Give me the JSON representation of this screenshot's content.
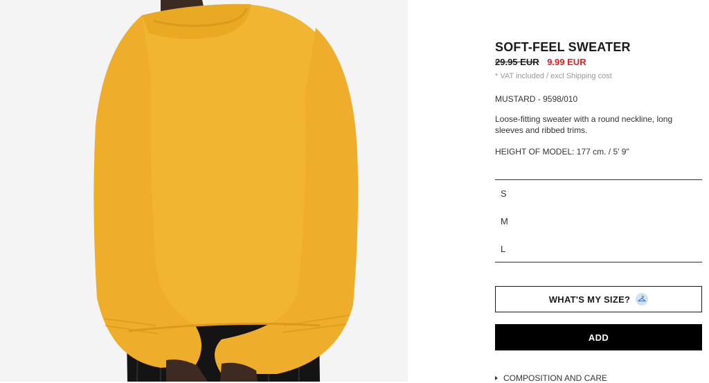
{
  "product": {
    "title": "SOFT-FEEL SWEATER",
    "old_price": "29.95 EUR",
    "new_price": "9.99 EUR",
    "vat_note": "* VAT included / excl Shipping cost",
    "color_ref": "MUSTARD - 9598/010",
    "description": "Loose-fitting sweater with a round neckline, long sleeves and ribbed trims.",
    "model_height": "HEIGHT OF MODEL: 177 cm. / 5' 9\""
  },
  "sizes": [
    {
      "label": "S"
    },
    {
      "label": "M"
    },
    {
      "label": "L"
    }
  ],
  "actions": {
    "whats_my_size": "WHAT'S MY SIZE?",
    "add": "ADD",
    "composition": "COMPOSITION AND CARE"
  },
  "colors": {
    "sale_price": "#e02020",
    "add_button_bg": "#000000",
    "sweater": "#f2b531",
    "hanger_badge": "#cfe3f5"
  },
  "icons": {
    "size_helper": "hanger-icon",
    "composition_toggle": "triangle-right-icon"
  }
}
